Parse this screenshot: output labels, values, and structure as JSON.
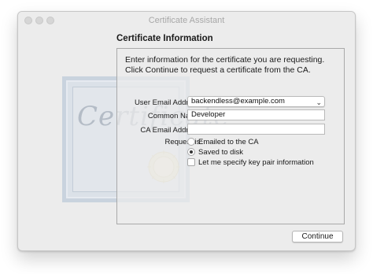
{
  "window": {
    "title": "Certificate Assistant"
  },
  "heading": "Certificate Information",
  "intro_text": "Enter information for the certificate you are requesting. Click Continue to request a certificate from the CA.",
  "form": {
    "email_label": "User Email Address:",
    "email_value": "backendless@example.com",
    "common_name_label": "Common Name:",
    "common_name_value": "Developer",
    "ca_email_label": "CA Email Address:",
    "ca_email_value": "",
    "request_label": "Request is:",
    "request_options": [
      {
        "label": "Emailed to the CA",
        "selected": false
      },
      {
        "label": "Saved to disk",
        "selected": true
      }
    ],
    "key_pair_checkbox_label": "Let me specify key pair information",
    "key_pair_checked": false
  },
  "buttons": {
    "continue_label": "Continue"
  },
  "certificate_art_text": "Certificate",
  "icons": {
    "select_chevron": "chevron-updown-icon"
  }
}
